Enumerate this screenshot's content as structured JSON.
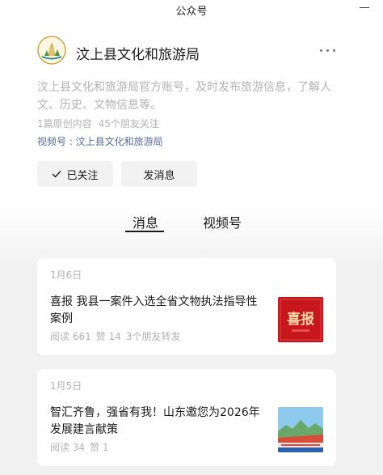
{
  "window": {
    "title": "公众号"
  },
  "account": {
    "name": "汶上县文化和旅游局",
    "description": "汶上县文化和旅游局官方账号，及时发布旅游信息，了解人文、历史、文物信息等。",
    "original_count": "1篇原创内容",
    "friends_following": "45个朋友关注",
    "channel": "视频号 : 汶上县文化和旅游局"
  },
  "actions": {
    "followed_label": "已关注",
    "message_label": "发消息"
  },
  "tabs": [
    {
      "label": "消息",
      "active": true
    },
    {
      "label": "视频号",
      "active": false
    }
  ],
  "articles": [
    {
      "date": "1月6日",
      "title": "喜报 我县一案件入选全省文物执法指导性案例",
      "reads": "阅读 661",
      "likes": "赞 14",
      "shares": "3个朋友转发",
      "thumb_text": "喜报"
    },
    {
      "date": "1月5日",
      "title": "智汇齐鲁，强省有我！山东邀您为2026年发展建言献策",
      "reads": "阅读 34",
      "likes": "赞 1"
    }
  ],
  "colors": {
    "link": "#576b95",
    "muted": "#b2b2b2",
    "thumb_red": "#c8161d"
  },
  "icons": [
    "minimize-icon",
    "more-icon",
    "check-icon"
  ]
}
